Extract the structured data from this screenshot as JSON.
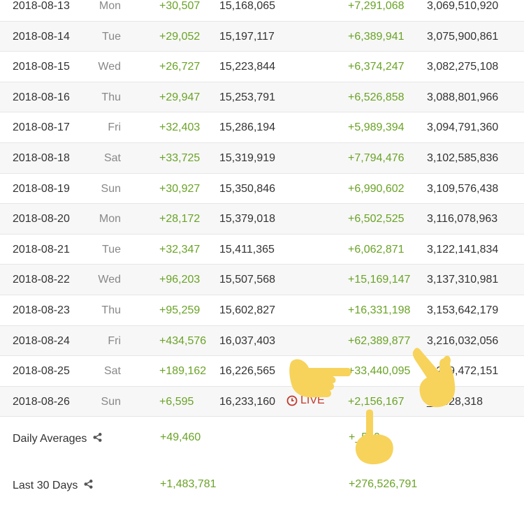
{
  "rows": [
    {
      "date": "2018-08-13",
      "dow": "Mon",
      "sub_change": "+30,507",
      "subs": "15,168,065",
      "views_change": "+7,291,068",
      "views": "3,069,510,920"
    },
    {
      "date": "2018-08-14",
      "dow": "Tue",
      "sub_change": "+29,052",
      "subs": "15,197,117",
      "views_change": "+6,389,941",
      "views": "3,075,900,861"
    },
    {
      "date": "2018-08-15",
      "dow": "Wed",
      "sub_change": "+26,727",
      "subs": "15,223,844",
      "views_change": "+6,374,247",
      "views": "3,082,275,108"
    },
    {
      "date": "2018-08-16",
      "dow": "Thu",
      "sub_change": "+29,947",
      "subs": "15,253,791",
      "views_change": "+6,526,858",
      "views": "3,088,801,966"
    },
    {
      "date": "2018-08-17",
      "dow": "Fri",
      "sub_change": "+32,403",
      "subs": "15,286,194",
      "views_change": "+5,989,394",
      "views": "3,094,791,360"
    },
    {
      "date": "2018-08-18",
      "dow": "Sat",
      "sub_change": "+33,725",
      "subs": "15,319,919",
      "views_change": "+7,794,476",
      "views": "3,102,585,836"
    },
    {
      "date": "2018-08-19",
      "dow": "Sun",
      "sub_change": "+30,927",
      "subs": "15,350,846",
      "views_change": "+6,990,602",
      "views": "3,109,576,438"
    },
    {
      "date": "2018-08-20",
      "dow": "Mon",
      "sub_change": "+28,172",
      "subs": "15,379,018",
      "views_change": "+6,502,525",
      "views": "3,116,078,963"
    },
    {
      "date": "2018-08-21",
      "dow": "Tue",
      "sub_change": "+32,347",
      "subs": "15,411,365",
      "views_change": "+6,062,871",
      "views": "3,122,141,834"
    },
    {
      "date": "2018-08-22",
      "dow": "Wed",
      "sub_change": "+96,203",
      "subs": "15,507,568",
      "views_change": "+15,169,147",
      "views": "3,137,310,981"
    },
    {
      "date": "2018-08-23",
      "dow": "Thu",
      "sub_change": "+95,259",
      "subs": "15,602,827",
      "views_change": "+16,331,198",
      "views": "3,153,642,179"
    },
    {
      "date": "2018-08-24",
      "dow": "Fri",
      "sub_change": "+434,576",
      "subs": "16,037,403",
      "views_change": "+62,389,877",
      "views": "3,216,032,056"
    },
    {
      "date": "2018-08-25",
      "dow": "Sat",
      "sub_change": "+189,162",
      "subs": "16,226,565",
      "views_change": "+33,440,095",
      "views": "3,2_9,472,151"
    },
    {
      "date": "2018-08-26",
      "dow": "Sun",
      "sub_change": "+6,595",
      "subs": "16,233,160",
      "live": "LIVE",
      "views_change": "+2,156,167",
      "views": "_1,628,318"
    }
  ],
  "summary": [
    {
      "label": "Daily Averages",
      "sub_value": "+49,460",
      "views_value": "+_560"
    },
    {
      "label": "Last 30 Days",
      "sub_value": "+1,483,781",
      "views_value": "+276,526,791"
    }
  ],
  "icons": {
    "live": "clock-icon",
    "share": "share-icon",
    "overlay": [
      "pointing-left-hand-emoji",
      "victory-hand-emoji",
      "pointing-up-hand-emoji"
    ]
  },
  "colors": {
    "positive": "#6aa326",
    "live": "#c0392b",
    "stripe": "#f7f7f7",
    "emoji": "#f7d35c"
  }
}
